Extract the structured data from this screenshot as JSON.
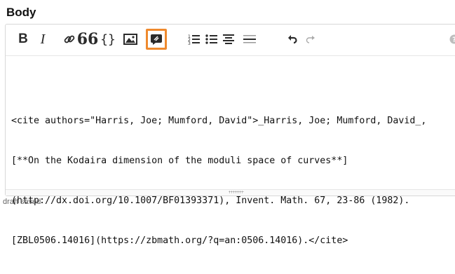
{
  "field": {
    "label": "Body"
  },
  "toolbar": {
    "bold_label": "B",
    "italic_label": "I",
    "quote_label": "66",
    "code_label": "{}",
    "icons": [
      "bold-icon",
      "italic-icon",
      "link-icon",
      "blockquote-icon",
      "code-icon",
      "image-icon",
      "citation-icon",
      "ordered-list-icon",
      "unordered-list-icon",
      "heading-icon",
      "horizontal-rule-icon",
      "undo-icon",
      "redo-icon",
      "help-icon"
    ],
    "highlight_color": "#ef8a2e"
  },
  "editor": {
    "lines": [
      "<cite authors=\"Harris, Joe; Mumford, David\">_Harris, Joe; Mumford, David_,",
      "[**On the Kodaira dimension of the moduli space of curves**]",
      "(http://dx.doi.org/10.1007/BF01393371), Invent. Math. 67, 23-86 (1982).",
      "[ZBL0506.14016](https://zbmath.org/?q=an:0506.14016).</cite>"
    ]
  },
  "footer": {
    "status": "draft saved"
  }
}
